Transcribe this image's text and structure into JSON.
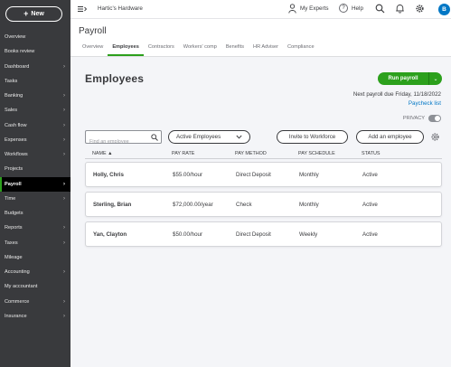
{
  "sidebar": {
    "new_label": "New",
    "items": [
      {
        "label": "Overview",
        "chevron": false,
        "active": false
      },
      {
        "label": "Books review",
        "chevron": false,
        "active": false
      },
      {
        "label": "Dashboard",
        "chevron": true,
        "active": false
      },
      {
        "label": "Tasks",
        "chevron": false,
        "active": false
      },
      {
        "label": "Banking",
        "chevron": true,
        "active": false
      },
      {
        "label": "Sales",
        "chevron": true,
        "active": false
      },
      {
        "label": "Cash flow",
        "chevron": true,
        "active": false
      },
      {
        "label": "Expenses",
        "chevron": true,
        "active": false
      },
      {
        "label": "Workflows",
        "chevron": true,
        "active": false
      },
      {
        "label": "Projects",
        "chevron": false,
        "active": false
      },
      {
        "label": "Payroll",
        "chevron": true,
        "active": true
      },
      {
        "label": "Time",
        "chevron": true,
        "active": false
      },
      {
        "label": "Budgets",
        "chevron": false,
        "active": false
      },
      {
        "label": "Reports",
        "chevron": true,
        "active": false
      },
      {
        "label": "Taxes",
        "chevron": true,
        "active": false
      },
      {
        "label": "Mileage",
        "chevron": false,
        "active": false
      },
      {
        "label": "Accounting",
        "chevron": true,
        "active": false
      },
      {
        "label": "My accountant",
        "chevron": false,
        "active": false
      },
      {
        "label": "Commerce",
        "chevron": true,
        "active": false
      },
      {
        "label": "Insurance",
        "chevron": true,
        "active": false
      }
    ]
  },
  "topbar": {
    "company": "Hartic's Hardware",
    "my_experts": "My Experts",
    "help": "Help",
    "avatar_initial": "B"
  },
  "header": {
    "title": "Payroll",
    "tabs": [
      "Overview",
      "Employees",
      "Contractors",
      "Workers' comp",
      "Benefits",
      "HR Adviser",
      "Compliance"
    ],
    "active_tab": "Employees"
  },
  "main": {
    "section_title": "Employees",
    "run_payroll_label": "Run payroll",
    "next_payroll": "Next payroll due Friday, 11/18/2022",
    "paycheck_list": "Paycheck list",
    "privacy_label": "PRIVACY",
    "search_placeholder": "Find an employee",
    "filter_value": "Active Employees",
    "invite_label": "Invite to Workforce",
    "add_employee_label": "Add an employee"
  },
  "table": {
    "headers": [
      "NAME ▲",
      "PAY RATE",
      "PAY METHOD",
      "PAY SCHEDULE",
      "STATUS"
    ],
    "rows": [
      {
        "name": "Holly, Chris",
        "rate": "$55.00/hour",
        "method": "Direct Deposit",
        "schedule": "Monthly",
        "status": "Active"
      },
      {
        "name": "Sterling, Brian",
        "rate": "$72,000.00/year",
        "method": "Check",
        "schedule": "Monthly",
        "status": "Active"
      },
      {
        "name": "Yan, Clayton",
        "rate": "$50.00/hour",
        "method": "Direct Deposit",
        "schedule": "Weekly",
        "status": "Active"
      }
    ]
  },
  "colors": {
    "brand_green": "#2ca01c",
    "sidebar_bg": "#393a3d",
    "link_blue": "#0077c5"
  }
}
